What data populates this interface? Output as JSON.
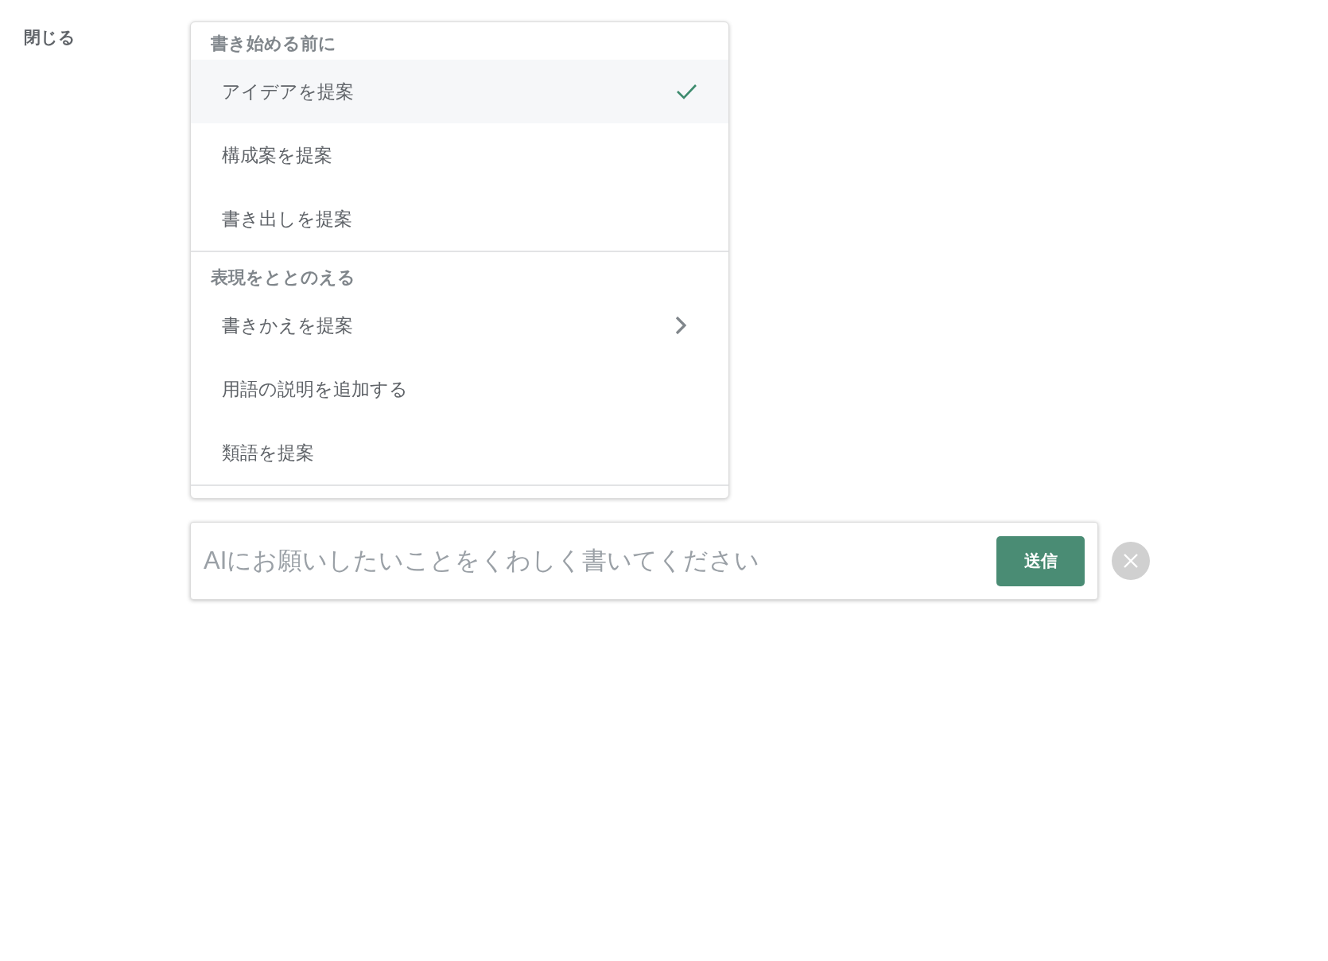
{
  "close_label": "閉じる",
  "menu": {
    "sections": [
      {
        "heading": "書き始める前に",
        "items": [
          {
            "label": "アイデアを提案",
            "selected": true,
            "has_submenu": false
          },
          {
            "label": "構成案を提案",
            "selected": false,
            "has_submenu": false
          },
          {
            "label": "書き出しを提案",
            "selected": false,
            "has_submenu": false
          }
        ]
      },
      {
        "heading": "表現をととのえる",
        "items": [
          {
            "label": "書きかえを提案",
            "selected": false,
            "has_submenu": true
          },
          {
            "label": "用語の説明を追加する",
            "selected": false,
            "has_submenu": false
          },
          {
            "label": "類語を提案",
            "selected": false,
            "has_submenu": false
          }
        ]
      }
    ]
  },
  "prompt": {
    "placeholder": "AIにお願いしたいことをくわしく書いてください",
    "send_label": "送信"
  }
}
